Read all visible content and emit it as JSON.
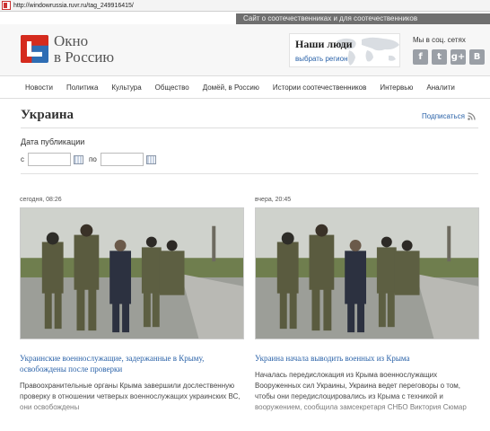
{
  "browser": {
    "url": "http://windowrussia.ruvr.ru/tag_249916415/"
  },
  "top_strip": {
    "text": "Сайт о соотечественниках и для соотечественников"
  },
  "header": {
    "logo_line1": "Окно",
    "logo_line2": "в Россию",
    "people_title": "Наши люди",
    "people_link": "выбрать регион",
    "social_label": "Мы в соц. сетях",
    "social_icons": [
      "facebook-icon",
      "twitter-icon",
      "google-plus-icon",
      "vkontakte-icon"
    ]
  },
  "nav": {
    "items": [
      "Новости",
      "Политика",
      "Культура",
      "Общество",
      "Домёй, в Россию",
      "Истории соотечественников",
      "Интервью",
      "Аналити"
    ]
  },
  "section": {
    "title": "Украина",
    "subscribe": "Подписаться"
  },
  "filter": {
    "label": "Дата публикации",
    "from_label": "с",
    "to_label": "по",
    "from_value": "",
    "to_value": ""
  },
  "articles": [
    {
      "time": "сегодня, 08:26",
      "headline": "Украинские военнослужащие, задержанные в Крыму, освобождены после проверки",
      "lead": "Правоохранительные органы Крыма завершили дослественную проверку в отношении четверых военнослужащих украинских ВС, они освобождены"
    },
    {
      "time": "вчера, 20:45",
      "headline": "Украина начала выводить военных из Крыма",
      "lead": "Началась передислокация из Крыма военнослужащих Вооруженных сил Украины, Украина ведет переговоры о том, чтобы они передислоцировались из Крыма с техникой и вооружением, сообщила замсекретаря СНБО Виктория Сюмар"
    }
  ],
  "colors": {
    "link": "#2a62a8",
    "strip": "#6f6f6f",
    "logo_red": "#d52b1e",
    "logo_blue": "#2e6db4"
  }
}
